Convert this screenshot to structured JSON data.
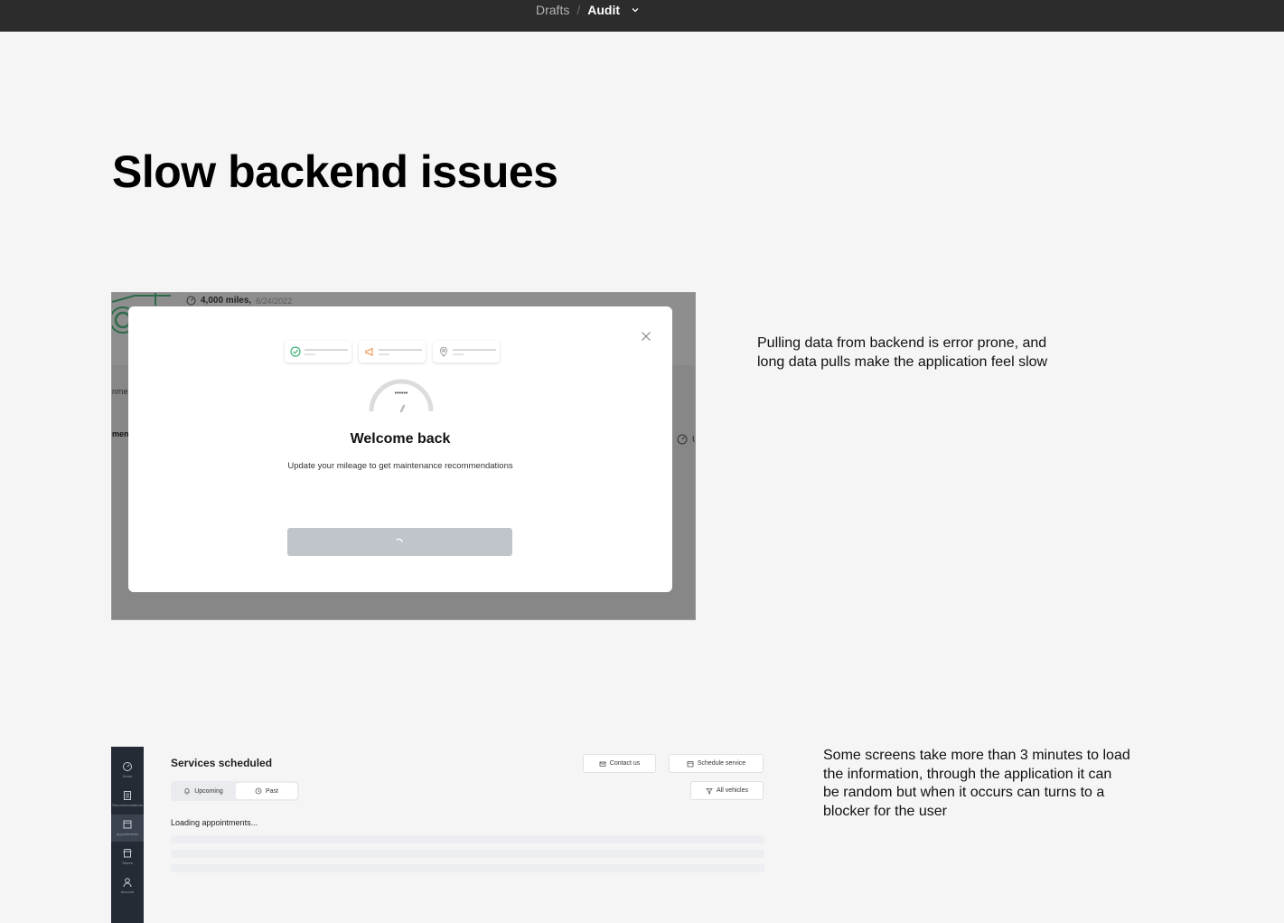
{
  "topbar": {
    "crumbs": [
      "Drafts",
      "Audit"
    ],
    "separator": "/",
    "icons": {
      "dropdown": "chevron-down-icon"
    }
  },
  "page": {
    "title": "Slow backend issues"
  },
  "notes": [
    "Pulling data from backend is error prone, and long data pulls make the application feel slow",
    "Some screens take more than 3 minutes to load the information, through the application it can be random but when it occurs can turns to a blocker for the user"
  ],
  "screenshot1": {
    "background": {
      "miles": "4,000 miles,",
      "date": "6/24/2022",
      "fragment_left_1": "nmer",
      "fragment_left_2": "men",
      "fragment_right": "U"
    },
    "modal": {
      "title": "Welcome back",
      "subtitle": "Update your mileage to get maintenance recommendations",
      "gauge_label": "••••••",
      "icons": {
        "close": "close-icon",
        "steps": [
          "check-circle-icon",
          "megaphone-icon",
          "location-pin-icon"
        ],
        "button": "spinner-icon"
      },
      "colors": {
        "check": "#3bb273",
        "megaphone": "#f08a4b",
        "button": "#c0c4cb"
      }
    }
  },
  "screenshot2": {
    "title": "Services scheduled",
    "tabs": [
      "Upcoming",
      "Past"
    ],
    "buttons": {
      "contact": "Contact us",
      "schedule": "Schedule service",
      "vehicles": "All vehicles"
    },
    "loading_text": "Loading appointments...",
    "sidebar": [
      {
        "label": "Home",
        "icon": "gauge-icon"
      },
      {
        "label": "Recommendations",
        "icon": "list-icon"
      },
      {
        "label": "Appointments",
        "icon": "calendar-icon",
        "active": true
      },
      {
        "label": "Stores",
        "icon": "store-icon"
      },
      {
        "label": "Account",
        "icon": "user-icon"
      }
    ],
    "colors": {
      "sidebar": "#252b35"
    }
  }
}
